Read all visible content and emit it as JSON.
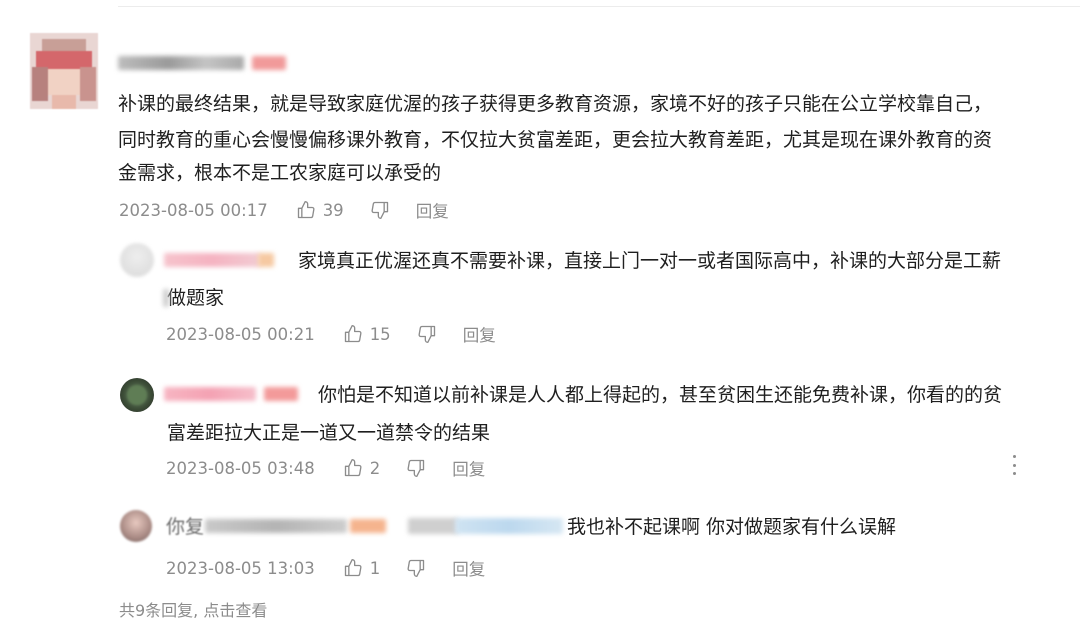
{
  "comment": {
    "text_lines": [
      "补课的最终结果，就是导致家庭优渥的孩子获得更多教育资源，家境不好的孩子只能在公立学校靠自己，",
      "同时教育的重心会慢慢偏移课外教育，不仅拉大贫富差距，更会拉大教育差距，尤其是现在课外教育的资",
      "金需求，根本不是工农家庭可以承受的"
    ],
    "time": "2023-08-05 00:17",
    "likes": "39",
    "reply_label": "回复"
  },
  "replies": [
    {
      "text_lines": [
        "家境真正优渥还真不需要补课，直接上门一对一或者国际高中，补课的大部分是工薪",
        "做题家"
      ],
      "time": "2023-08-05 00:21",
      "likes": "15",
      "reply_label": "回复"
    },
    {
      "text_lines": [
        "你怕是不知道以前补课是人人都上得起的，甚至贫困生还能免费补课，你看的的贫",
        "富差距拉大正是一道又一道禁令的结果"
      ],
      "time": "2023-08-05 03:48",
      "likes": "2",
      "reply_label": "回复"
    },
    {
      "prefix": "你复",
      "text_lines": [
        "我也补不起课啊 你对做题家有什么误解"
      ],
      "time": "2023-08-05 13:03",
      "likes": "1",
      "reply_label": "回复"
    }
  ],
  "footer": {
    "view_all": "共9条回复, 点击查看"
  },
  "icons": {
    "like": "thumbs-up-icon",
    "dislike": "thumbs-down-icon",
    "more": "more-vertical-icon"
  },
  "colors": {
    "text": "#1f1f1f",
    "meta": "#8c8c8c",
    "divider": "#ececec"
  }
}
